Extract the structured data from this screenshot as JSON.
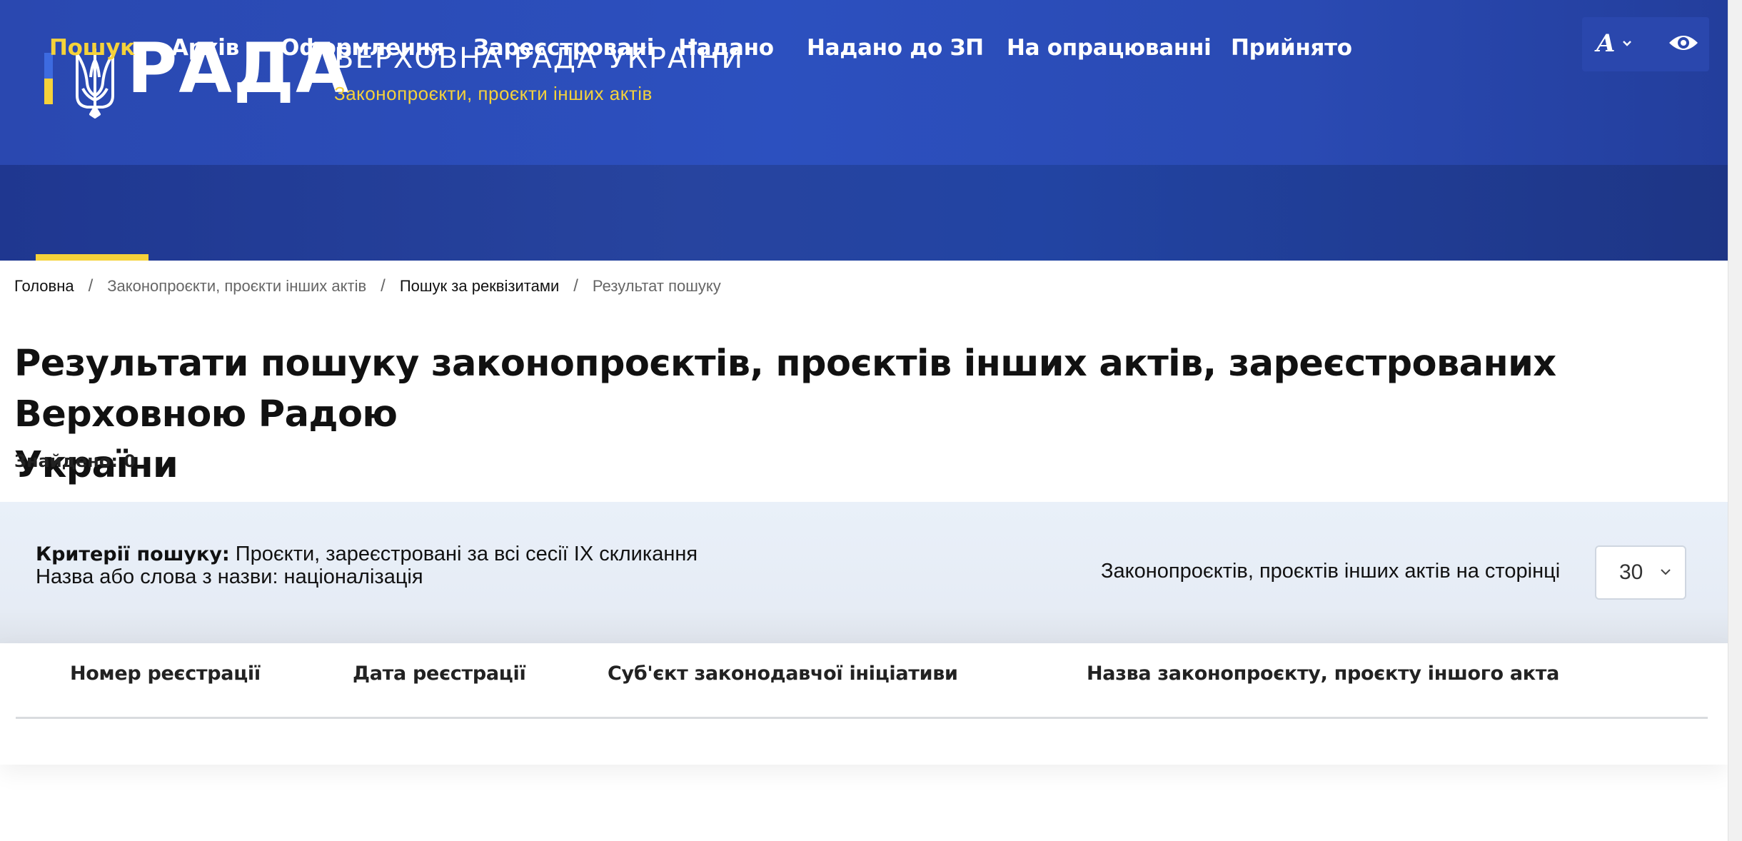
{
  "header": {
    "logo_word": "РАДА",
    "institution_title": "ВЕРХОВНА РАДА УКРАЇНИ",
    "section_subtitle": "Законопроєкти, проєкти інших актів",
    "font_size_button": "A",
    "font_size_icon": "chevron-down-icon",
    "visibility_icon": "eye-icon",
    "colors": {
      "brand_blue": "#2c50bf",
      "accent_yellow": "#f5d23a"
    }
  },
  "nav": {
    "items": [
      {
        "label": "Пошук",
        "active": true
      },
      {
        "label": "Архів",
        "active": false
      },
      {
        "label": "Оформлення",
        "active": false
      },
      {
        "label": "Зареєстровані",
        "active": false
      },
      {
        "label": "Надано",
        "active": false
      },
      {
        "label": "Надано до ЗП",
        "active": false
      },
      {
        "label": "На опрацюванні",
        "active": false
      },
      {
        "label": "Прийнято",
        "active": false
      }
    ]
  },
  "breadcrumbs": [
    {
      "label": "Головна"
    },
    {
      "label": "Законопроєкти, проєкти інших актів"
    },
    {
      "label": "Пошук за реквізитами"
    },
    {
      "label": "Результат пошуку"
    }
  ],
  "main": {
    "title_line1": "Результати пошуку законопроєктів, проєктів інших актів, зареєстрованих Верховною Радою",
    "title_line2": "України",
    "found_text": "Знайдено: 0"
  },
  "criteria": {
    "label": "Критерії пошуку:",
    "value": "Проєкти, зареєстровані за всі сесії IX скликання",
    "name_filter": "Назва або слова з назви: націоналізація",
    "per_page_label": "Законопроєктів, проєктів інших актів на сторінці",
    "per_page_value": "30"
  },
  "table": {
    "headers": [
      "Номер реєстрації",
      "Дата реєстрації",
      "Суб'єкт законодавчої ініціативи",
      "Назва законопроєкту, проєкту іншого акта"
    ],
    "rows": []
  }
}
